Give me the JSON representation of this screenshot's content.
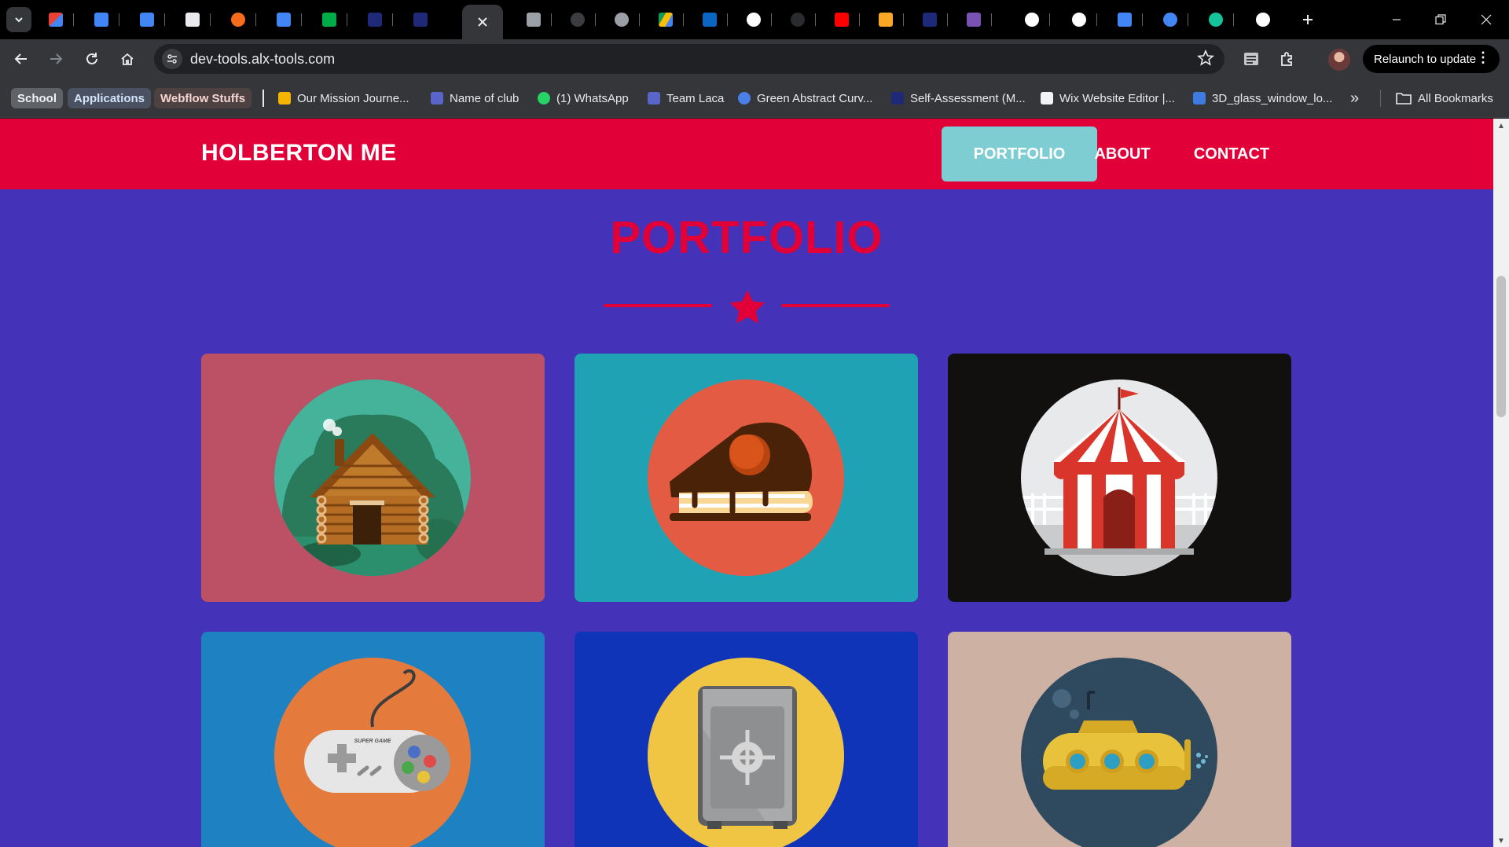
{
  "browser": {
    "url": "dev-tools.alx-tools.com",
    "relaunch_label": "Relaunch to update",
    "bookmarks": {
      "chips": [
        "School",
        "Applications",
        "Webflow Stuffs"
      ],
      "items": [
        "Our Mission Journe...",
        "Name of club",
        "(1) WhatsApp",
        "Team Laca",
        "Green Abstract Curv...",
        "Self-Assessment (M...",
        "Wix Website Editor |...",
        "3D_glass_window_lo..."
      ],
      "overflow": "»",
      "all_bookmarks": "All Bookmarks"
    }
  },
  "site": {
    "brand": "HOLBERTON ME",
    "nav": [
      "PORTFOLIO",
      "ABOUT",
      "CONTACT"
    ],
    "section_title": "PORTFOLIO",
    "colors": {
      "header": "#e10038",
      "page_bg": "#4433b8",
      "active_nav": "#7ecdd2"
    },
    "portfolio": [
      {
        "icon": "cabin-icon",
        "bg": "#bc5166"
      },
      {
        "icon": "cake-slice-icon",
        "bg": "#1fa3b4"
      },
      {
        "icon": "circus-tent-icon",
        "bg": "#120f0f"
      },
      {
        "icon": "game-controller-icon",
        "bg": "#1e82c2"
      },
      {
        "icon": "safe-icon",
        "bg": "#1034b8"
      },
      {
        "icon": "submarine-icon",
        "bg": "#cdb1a2"
      }
    ],
    "controller_label": "SUPER GAME"
  }
}
